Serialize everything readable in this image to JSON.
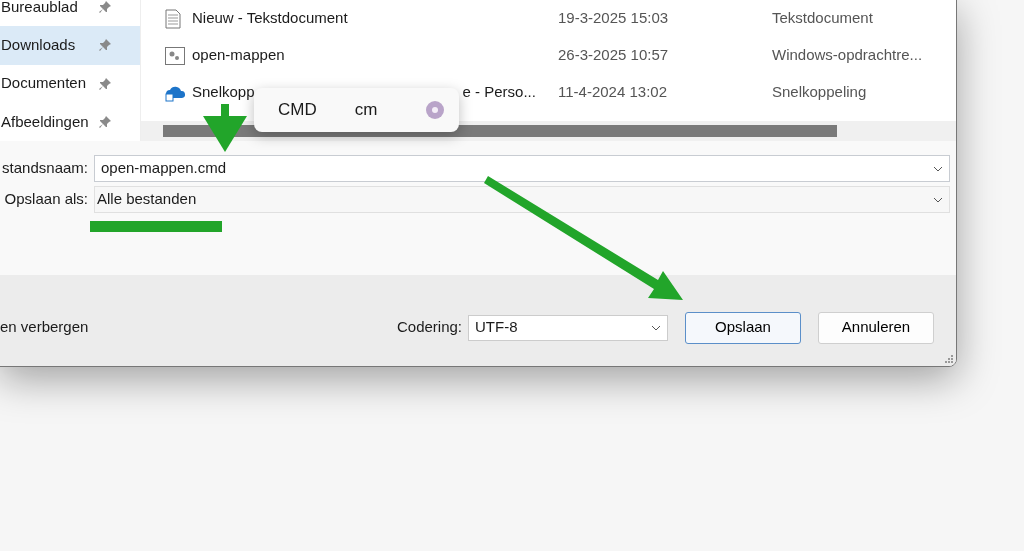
{
  "sidebar": {
    "items": [
      {
        "label": "Bureaublad",
        "pinned": true,
        "selected": false
      },
      {
        "label": "Downloads",
        "pinned": true,
        "selected": true
      },
      {
        "label": "Documenten",
        "pinned": true,
        "selected": false
      },
      {
        "label": "Afbeeldingen",
        "pinned": true,
        "selected": false
      }
    ]
  },
  "files": [
    {
      "kind": "text",
      "name": "Nieuw - Tekstdocument",
      "date": "19-3-2025 15:03",
      "type": "Tekstdocument"
    },
    {
      "kind": "script",
      "name": "open-mappen",
      "date": "26-3-2025 10:57",
      "type": "Windows-opdrachtre..."
    },
    {
      "kind": "shortcut",
      "name": "Snelkopp",
      "name_tail": "e - Perso...",
      "date": "11-4-2024 13:02",
      "type": "Snelkoppeling"
    }
  ],
  "ime_popup": {
    "candidates": [
      "CMD",
      "cm"
    ]
  },
  "filename": {
    "label": "standsnaam:",
    "value": "open-mappen.cmd"
  },
  "save_as": {
    "label": "Opslaan als:",
    "value": "Alle bestanden"
  },
  "hide_folders": {
    "label": "en verbergen"
  },
  "encoding": {
    "label": "Codering:",
    "value": "UTF-8"
  },
  "buttons": [
    {
      "label": "Opslaan",
      "kind": "default"
    },
    {
      "label": "Annuleren",
      "kind": "normal"
    }
  ]
}
